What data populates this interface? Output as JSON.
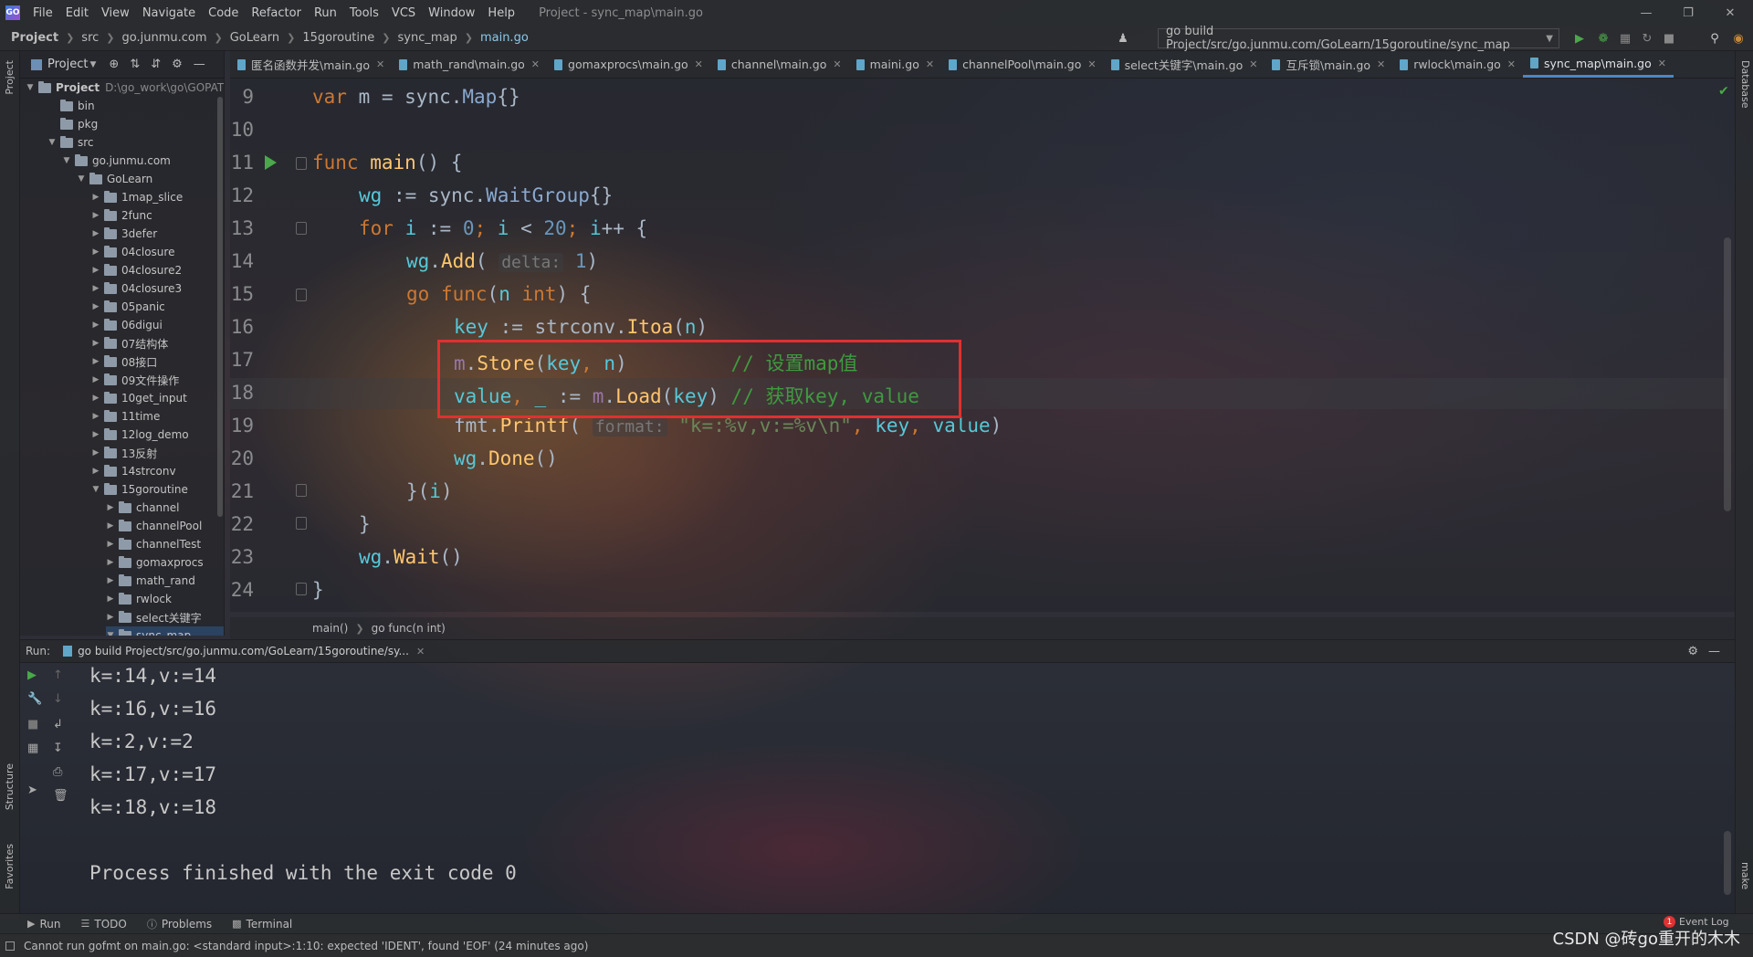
{
  "window": {
    "menus": [
      "File",
      "Edit",
      "View",
      "Navigate",
      "Code",
      "Refactor",
      "Run",
      "Tools",
      "VCS",
      "Window",
      "Help"
    ],
    "title": "Project - sync_map\\main.go"
  },
  "breadcrumbs": [
    "Project",
    "src",
    "go.junmu.com",
    "GoLearn",
    "15goroutine",
    "sync_map",
    "main.go"
  ],
  "run_config": {
    "label": "go build Project/src/go.junmu.com/GoLearn/15goroutine/sync_map"
  },
  "project_panel": {
    "title": "Project",
    "root_label": "Project",
    "root_path": "D:\\go_work\\go\\GOPAT",
    "items": [
      {
        "label": "bin",
        "expanded": false
      },
      {
        "label": "pkg",
        "expanded": false
      },
      {
        "label": "src",
        "expanded": true
      },
      {
        "label": "go.junmu.com",
        "expanded": true
      },
      {
        "label": "GoLearn",
        "expanded": true
      },
      {
        "label": "1map_slice",
        "expanded": false
      },
      {
        "label": "2func",
        "expanded": false
      },
      {
        "label": "3defer",
        "expanded": false
      },
      {
        "label": "04closure",
        "expanded": false
      },
      {
        "label": "04closure2",
        "expanded": false
      },
      {
        "label": "04closure3",
        "expanded": false
      },
      {
        "label": "05panic",
        "expanded": false
      },
      {
        "label": "06digui",
        "expanded": false
      },
      {
        "label": "07结构体",
        "expanded": false
      },
      {
        "label": "08接口",
        "expanded": false
      },
      {
        "label": "09文件操作",
        "expanded": false
      },
      {
        "label": "10get_input",
        "expanded": false
      },
      {
        "label": "11time",
        "expanded": false
      },
      {
        "label": "12log_demo",
        "expanded": false
      },
      {
        "label": "13反射",
        "expanded": false
      },
      {
        "label": "14strconv",
        "expanded": false
      },
      {
        "label": "15goroutine",
        "expanded": true
      },
      {
        "label": "channel",
        "expanded": false
      },
      {
        "label": "channelPool",
        "expanded": false
      },
      {
        "label": "channelTest",
        "expanded": false
      },
      {
        "label": "gomaxprocs",
        "expanded": false
      },
      {
        "label": "math_rand",
        "expanded": false
      },
      {
        "label": "rwlock",
        "expanded": false
      },
      {
        "label": "select关键字",
        "expanded": false
      },
      {
        "label": "sync_map",
        "expanded": true
      }
    ]
  },
  "tabs": [
    {
      "label": "匿名函数并发\\main.go",
      "active": false
    },
    {
      "label": "math_rand\\main.go",
      "active": false
    },
    {
      "label": "gomaxprocs\\main.go",
      "active": false
    },
    {
      "label": "channel\\main.go",
      "active": false
    },
    {
      "label": "maini.go",
      "active": false
    },
    {
      "label": "channelPool\\main.go",
      "active": false
    },
    {
      "label": "select关键字\\main.go",
      "active": false
    },
    {
      "label": "互斥锁\\main.go",
      "active": false
    },
    {
      "label": "rwlock\\main.go",
      "active": false
    },
    {
      "label": "sync_map\\main.go",
      "active": true
    }
  ],
  "editor": {
    "line_numbers": [
      "9",
      "10",
      "11",
      "12",
      "13",
      "14",
      "15",
      "16",
      "17",
      "18",
      "19",
      "20",
      "21",
      "22",
      "23",
      "24"
    ],
    "code": {
      "l9_var": "var",
      "l9_rest": " m = sync.",
      "l9_type": "Map",
      "l9_end": "{}",
      "l11_func": "func",
      "l11_name": "main",
      "l11_end": "() {",
      "l12_wg": "wg",
      "l12_mid": " := sync.",
      "l12_type": "WaitGroup",
      "l12_end": "{}",
      "l13_for": "for",
      "l13_i": "i",
      "l13_a": " := ",
      "l13_zero": "0",
      "l13_b": "; ",
      "l13_i2": "i",
      "l13_c": " < ",
      "l13_twenty": "20",
      "l13_d": "; ",
      "l13_i3": "i",
      "l13_e": "++ {",
      "l14_wg": "wg",
      "l14_dot": ".",
      "l14_fn": "Add",
      "l14_open": "(",
      "l14_hint": "delta:",
      "l14_num": "1",
      "l14_close": ")",
      "l15_go": "go",
      "l15_func": "func",
      "l15_open": "(",
      "l15_n": "n",
      "l15_int": "int",
      "l15_close": ") {",
      "l16_key": "key",
      "l16_mid": " := strconv.",
      "l16_fn": "Itoa",
      "l16_open": "(",
      "l16_n": "n",
      "l16_close": ")",
      "l17_m": "m",
      "l17_dot": ".",
      "l17_fn": "Store",
      "l17_open": "(",
      "l17_key": "key",
      "l17_comma": ", ",
      "l17_n": "n",
      "l17_close": ")",
      "l17_comment": "// 设置map值",
      "l18_value": "value",
      "l18_a": ", ",
      "l18_us": "_",
      "l18_b": " := ",
      "l18_m": "m",
      "l18_dot": ".",
      "l18_fn": "Load",
      "l18_open": "(",
      "l18_key": "key",
      "l18_close": ")",
      "l18_comment": "// 获取key, value",
      "l19_pkg": "fmt.",
      "l19_fn": "Printf",
      "l19_open": "(",
      "l19_hint": "format:",
      "l19_str": "\"k=:%v,v:=%v\\n\"",
      "l19_comma": ", ",
      "l19_key": "key",
      "l19_comma2": ", ",
      "l19_value": "value",
      "l19_close": ")",
      "l20_wg": "wg",
      "l20_dot": ".",
      "l20_fn": "Done",
      "l20_end": "()",
      "l21_a": "}(",
      "l21_i": "i",
      "l21_b": ")",
      "l22": "}",
      "l23_wg": "wg",
      "l23_dot": ".",
      "l23_fn": "Wait",
      "l23_end": "()",
      "l24": "}"
    }
  },
  "code_breadcrumb": [
    "main()",
    "go func(n int)"
  ],
  "run_panel": {
    "label": "Run:",
    "tab": "go build Project/src/go.junmu.com/GoLearn/15goroutine/sy...",
    "output": [
      "k=:14,v:=14",
      "k=:16,v:=16",
      "k=:2,v:=2",
      "k=:17,v:=17",
      "k=:18,v:=18",
      "",
      "Process finished with the exit code 0"
    ]
  },
  "left_strip": {
    "project": "Project",
    "structure": "Structure",
    "favorites": "Favorites"
  },
  "right_strip": {
    "database": "Database",
    "make": "make"
  },
  "bottom_tools": [
    {
      "label": "Run",
      "icon": "play-icon"
    },
    {
      "label": "TODO",
      "icon": "list-icon"
    },
    {
      "label": "Problems",
      "icon": "info-icon"
    },
    {
      "label": "Terminal",
      "icon": "terminal-icon"
    }
  ],
  "event_log": {
    "label": "Event Log",
    "count": "1"
  },
  "status": {
    "message": "Cannot run gofmt on main.go: <standard input>:1:10: expected 'IDENT', found 'EOF' (24 minutes ago)"
  },
  "watermark": "CSDN @砖go重开的木木",
  "colors": {
    "accent": "#4a88c7",
    "highlight_box": "#e03030",
    "run_green": "#4aa84a"
  }
}
